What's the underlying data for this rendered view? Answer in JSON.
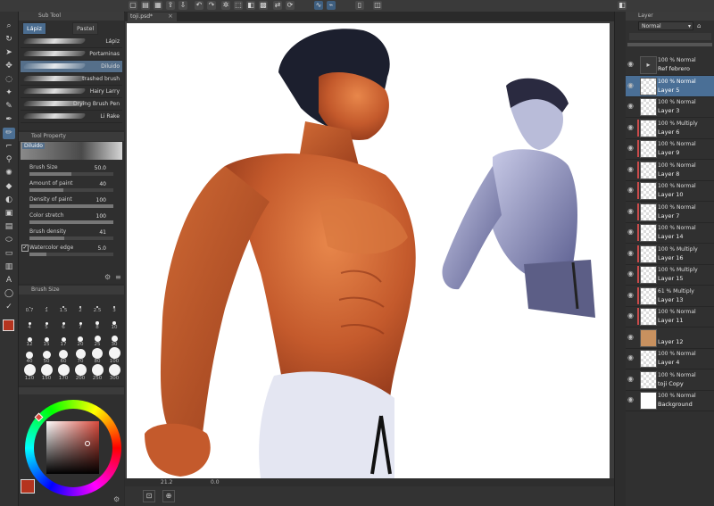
{
  "document": {
    "tab_title": "toji.psd*",
    "zoom": "21.2",
    "angle": "0.0"
  },
  "subtool": {
    "header": "Sub Tool",
    "tabs": [
      {
        "label": "Lápiz",
        "active": true
      },
      {
        "label": "Pastel",
        "active": false
      }
    ],
    "brushes": [
      {
        "label": "Lápiz"
      },
      {
        "label": "Portaminas"
      },
      {
        "label": "Diluido"
      },
      {
        "label": "trashed brush"
      },
      {
        "label": "Hairy Larry"
      },
      {
        "label": "Drying Brush Pen"
      },
      {
        "label": "Li Rake"
      }
    ],
    "selected_index": 2
  },
  "tool_property": {
    "header": "Tool Property",
    "preset": "Diluido",
    "props": [
      {
        "label": "Brush Size",
        "value": "50.0",
        "fill": 0.5
      },
      {
        "label": "Amount of paint",
        "value": "40",
        "fill": 0.4
      },
      {
        "label": "Density of paint",
        "value": "100",
        "fill": 1.0
      },
      {
        "label": "Color stretch",
        "value": "100",
        "fill": 1.0
      },
      {
        "label": "Brush density",
        "value": "41",
        "fill": 0.41
      },
      {
        "label": "Watercolor edge",
        "value": "5.0",
        "fill": 0.2,
        "checked": true
      }
    ]
  },
  "brush_size": {
    "header": "Brush Size",
    "sizes": [
      "0.7",
      "1",
      "1.5",
      "2",
      "2.5",
      "3",
      "4",
      "5",
      "6",
      "7",
      "8",
      "10",
      "12",
      "15",
      "17",
      "20",
      "25",
      "30",
      "40",
      "50",
      "60",
      "70",
      "80",
      "100",
      "120",
      "150",
      "170",
      "200",
      "250",
      "300"
    ]
  },
  "colors": {
    "main": "#b5341f",
    "sub": "#ffffff",
    "picker_hue": "#d94a3c"
  },
  "layer_panel": {
    "header": "Layer",
    "blend_mode": "Normal",
    "layers": [
      {
        "mode": "100 % Normal",
        "name": "Ref febrero",
        "folder": true
      },
      {
        "mode": "100 % Normal",
        "name": "Layer 5",
        "selected": true
      },
      {
        "mode": "100 % Normal",
        "name": "Layer 3"
      },
      {
        "mode": "100 % Multiply",
        "name": "Layer 6",
        "marked": true
      },
      {
        "mode": "100 % Normal",
        "name": "Layer 9",
        "marked": true
      },
      {
        "mode": "100 % Normal",
        "name": "Layer 8",
        "marked": true
      },
      {
        "mode": "100 % Normal",
        "name": "Layer 10",
        "marked": true
      },
      {
        "mode": "100 % Normal",
        "name": "Layer 7",
        "marked": true
      },
      {
        "mode": "100 % Normal",
        "name": "Layer 14",
        "marked": true
      },
      {
        "mode": "100 % Multiply",
        "name": "Layer 16",
        "marked": true
      },
      {
        "mode": "100 % Multiply",
        "name": "Layer 15",
        "marked": true
      },
      {
        "mode": "61 % Multiply",
        "name": "Layer 13",
        "marked": true
      },
      {
        "mode": "100 % Normal",
        "name": "Layer 11",
        "marked": true
      },
      {
        "mode": "",
        "name": "Layer 12",
        "fill": "#c8915f"
      },
      {
        "mode": "100 % Normal",
        "name": "Layer 4"
      },
      {
        "mode": "100 % Normal",
        "name": "toji Copy"
      },
      {
        "mode": "100 % Normal",
        "name": "Background",
        "fill": "#ffffff"
      }
    ]
  }
}
